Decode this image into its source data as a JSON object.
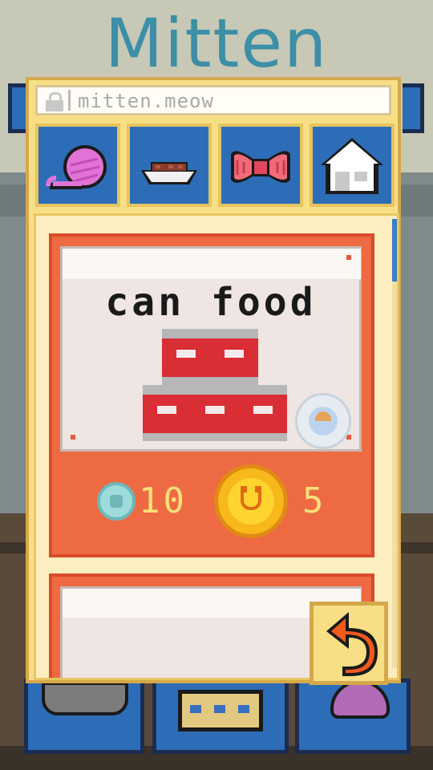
{
  "app": {
    "title": "Mitten"
  },
  "browser": {
    "url": "mitten.meow"
  },
  "tabs": [
    {
      "name": "yarn",
      "icon": "yarn-ball-icon"
    },
    {
      "name": "food",
      "icon": "food-bowl-icon"
    },
    {
      "name": "bow",
      "icon": "bow-icon"
    },
    {
      "name": "home",
      "icon": "house-icon"
    }
  ],
  "item": {
    "name": "can food",
    "icon": "can-stack-icon",
    "badge_icon": "muffin-plate-icon",
    "cost_gems": "10",
    "cost_coins": "5"
  },
  "buttons": {
    "back_icon": "undo-arrow-icon"
  },
  "colors": {
    "title": "#3b8fa7",
    "panel": "#f8df86",
    "tab": "#2d6db7",
    "card": "#ee6a42",
    "can": "#d92e34",
    "coin": "#f7b81c",
    "gem": "#9edcdc"
  }
}
